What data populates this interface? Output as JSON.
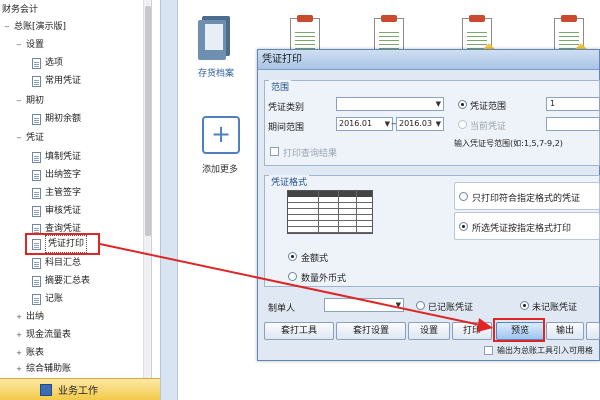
{
  "tree": {
    "items": [
      {
        "label": "财务会计",
        "toggle": ""
      },
      {
        "label": "总账[演示版]",
        "toggle": "−"
      },
      {
        "label": "设置",
        "toggle": "−"
      },
      {
        "label": "选项",
        "toggle": ""
      },
      {
        "label": "常用凭证",
        "toggle": ""
      },
      {
        "label": "期初",
        "toggle": "−"
      },
      {
        "label": "期初余额",
        "toggle": ""
      },
      {
        "label": "凭证",
        "toggle": "−"
      },
      {
        "label": "填制凭证",
        "toggle": ""
      },
      {
        "label": "出纳签字",
        "toggle": ""
      },
      {
        "label": "主管签字",
        "toggle": ""
      },
      {
        "label": "审核凭证",
        "toggle": ""
      },
      {
        "label": "查询凭证",
        "toggle": ""
      },
      {
        "label": "凭证打印",
        "toggle": ""
      },
      {
        "label": "科目汇总",
        "toggle": ""
      },
      {
        "label": "摘要汇总表",
        "toggle": ""
      },
      {
        "label": "记账",
        "toggle": ""
      },
      {
        "label": "出纳",
        "toggle": "+"
      },
      {
        "label": "现金流量表",
        "toggle": "+"
      },
      {
        "label": "账表",
        "toggle": "+"
      },
      {
        "label": "综合辅助账",
        "toggle": "+"
      }
    ],
    "selected_label": "凭证打印"
  },
  "bottom_tab": {
    "label": "业务工作"
  },
  "desktop": {
    "archive_label": "存货档案",
    "add_label": "添加更多",
    "add_symbol": "+"
  },
  "dialog": {
    "title": "凭证打印",
    "range_group": "范围",
    "voucher_type_label": "凭证类别",
    "voucher_type_value": "",
    "period_label": "期间范围",
    "period_from": "2016.01",
    "period_to": "2016.03",
    "period_sep": "—",
    "radio_voucher_range": "凭证范围",
    "voucher_range_value": "1",
    "radio_current_voucher": "当前凭证",
    "print_query_result": "打印查询结果",
    "input_hint": "输入凭证号范围(如:1,5,7-9,2)",
    "format_group": "凭证格式",
    "opt_specified_only": "只打印符合指定格式的凭证",
    "opt_print_by_format": "所选凭证按指定格式打印",
    "radio_amount": "金额式",
    "radio_foreign": "数量外币式",
    "preparer_label": "制单人",
    "preparer_value": "",
    "radio_posted": "已记账凭证",
    "radio_unposted": "未记账凭证",
    "buttons": [
      "套打工具",
      "套打设置",
      "设置",
      "打印",
      "预览",
      "输出"
    ],
    "export_check": "输出为总账工具引入可用格"
  }
}
